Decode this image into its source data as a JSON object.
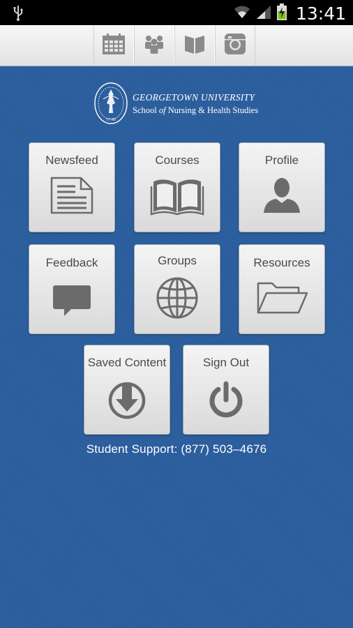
{
  "status_bar": {
    "time": "13:41"
  },
  "toolbar": {
    "buttons": [
      {
        "name": "calendar-icon"
      },
      {
        "name": "people-icon"
      },
      {
        "name": "book-icon"
      },
      {
        "name": "instagram-icon"
      }
    ]
  },
  "header": {
    "university": "GEORGETOWN UNIVERSITY",
    "school_prefix": "School ",
    "school_of": "of",
    "school_suffix": " Nursing & Health Studies",
    "seal_years": "17 89"
  },
  "tiles": {
    "newsfeed": "Newsfeed",
    "courses": "Courses",
    "profile": "Profile",
    "feedback": "Feedback",
    "groups": "Groups",
    "resources": "Resources",
    "saved": "Saved Content",
    "signout": "Sign Out"
  },
  "support": "Student Support: (877) 503–4676",
  "colors": {
    "background": "#2b5e9e",
    "tile": "#e8e8e8",
    "icon": "#6b6b6b"
  }
}
